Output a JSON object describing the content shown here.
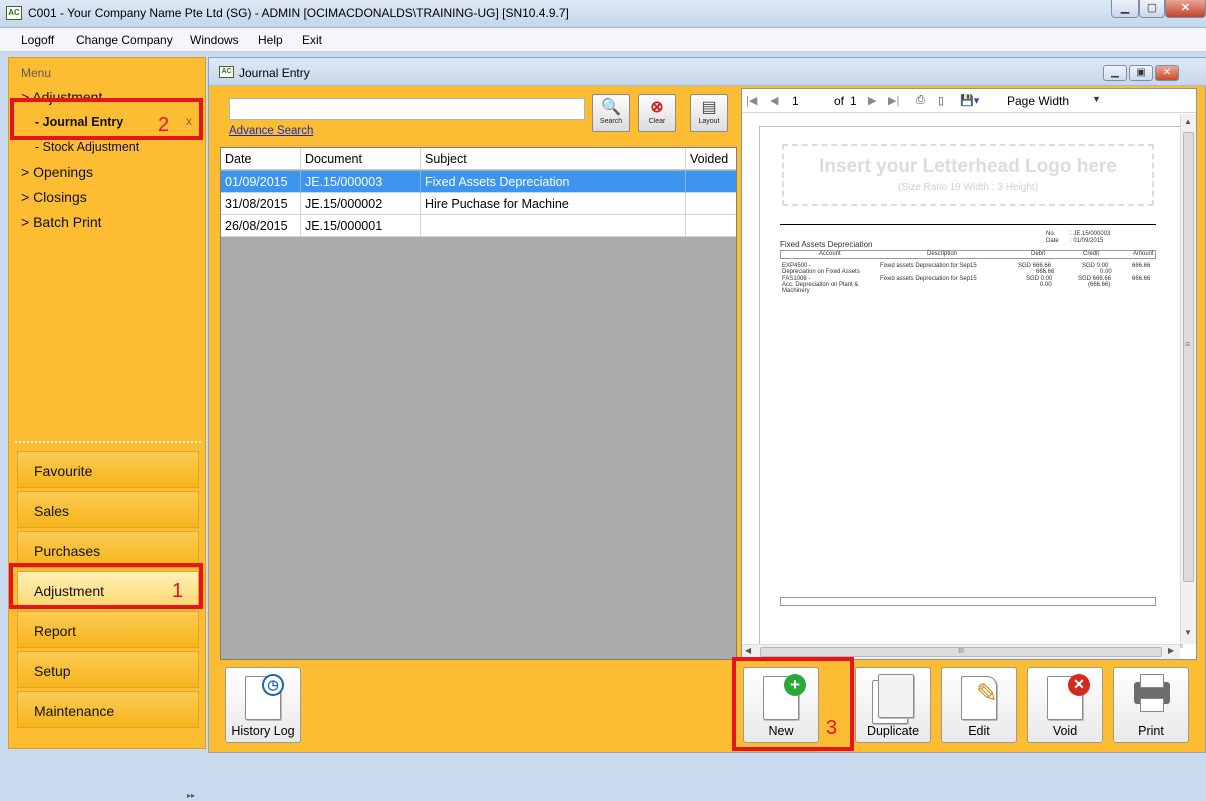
{
  "window": {
    "title": "C001 - Your Company Name Pte Ltd (SG) - ADMIN [OCIMACDONALDS\\TRAINING-UG] [SN10.4.9.7]",
    "app_icon": "AC"
  },
  "menubar": [
    "Logoff",
    "Change Company",
    "Windows",
    "Help",
    "Exit"
  ],
  "sidebar": {
    "heading": "Menu",
    "tree": [
      {
        "label": "> Adjustment"
      },
      {
        "label": "- Journal Entry",
        "active": true,
        "close": "x"
      },
      {
        "label": "- Stock Adjustment"
      },
      {
        "label": "> Openings"
      },
      {
        "label": "> Closings"
      },
      {
        "label": "> Batch Print"
      }
    ],
    "nav": [
      "Favourite",
      "Sales",
      "Purchases",
      "Adjustment",
      "Report",
      "Setup",
      "Maintenance"
    ],
    "selected_nav": "Adjustment"
  },
  "annotations": [
    "1",
    "2",
    "3"
  ],
  "journal_window": {
    "title": "Journal Entry",
    "search_value": "",
    "advance_search": "Advance Search",
    "tools": [
      {
        "label": "Search",
        "icon": "magnifier-icon"
      },
      {
        "label": "Clear",
        "icon": "clear-icon"
      },
      {
        "label": "Layout",
        "icon": "layout-icon"
      }
    ],
    "columns": [
      "Date",
      "Document",
      "Subject",
      "Voided"
    ],
    "rows": [
      {
        "date": "01/09/2015",
        "doc": "JE.15/000003",
        "subject": "Fixed Assets Depreciation",
        "voided": "",
        "selected": true
      },
      {
        "date": "31/08/2015",
        "doc": "JE.15/000002",
        "subject": "Hire Puchase for Machine",
        "voided": ""
      },
      {
        "date": "26/08/2015",
        "doc": "JE.15/000001",
        "subject": "",
        "voided": ""
      }
    ]
  },
  "preview": {
    "page": "1",
    "of_label": "of",
    "total": "1",
    "zoom": "Page Width",
    "logo_title": "Insert your Letterhead Logo here",
    "logo_sub": "(Size Ratio 19 Width : 3 Height)",
    "report": {
      "no_label": "No.",
      "no_value": ": JE.15/000003",
      "date_label": "Date",
      "date_value": ": 01/09/2015",
      "heading": "Fixed Assets Depreciation",
      "cols": [
        "Account",
        "Description",
        "Debit",
        "Credit",
        "Amount"
      ],
      "lines": [
        {
          "account": "EXP4500 -",
          "account2": "Depreciation on Fixed Assets",
          "desc": "Fixed assets Depreciation for Sep15",
          "debit": "SGD 666.66",
          "debit2": "666.66",
          "credit": "SGD 0.00",
          "credit2": "0.00",
          "amount": "666.66"
        },
        {
          "account": "FAS1006 -",
          "account2": "Acc. Depreciation on Plant &",
          "account3": "Machinery",
          "desc": "Fixed assets Depreciation for Sep15",
          "debit": "SGD 0.00",
          "debit2": "0.00",
          "credit": "SGD 666.66",
          "credit2": "(666.66)",
          "amount": "666.66"
        }
      ]
    },
    "hscroll_grip": "III",
    "vscroll_grip": "≡"
  },
  "bottom_buttons": [
    {
      "label": "History Log",
      "icon": "clock-icon"
    },
    {
      "label": "New",
      "icon": "add-icon"
    },
    {
      "label": "Duplicate",
      "icon": "duplicate-icon"
    },
    {
      "label": "Edit",
      "icon": "pencil-icon"
    },
    {
      "label": "Void",
      "icon": "void-icon"
    },
    {
      "label": "Print",
      "icon": "printer-icon"
    }
  ]
}
